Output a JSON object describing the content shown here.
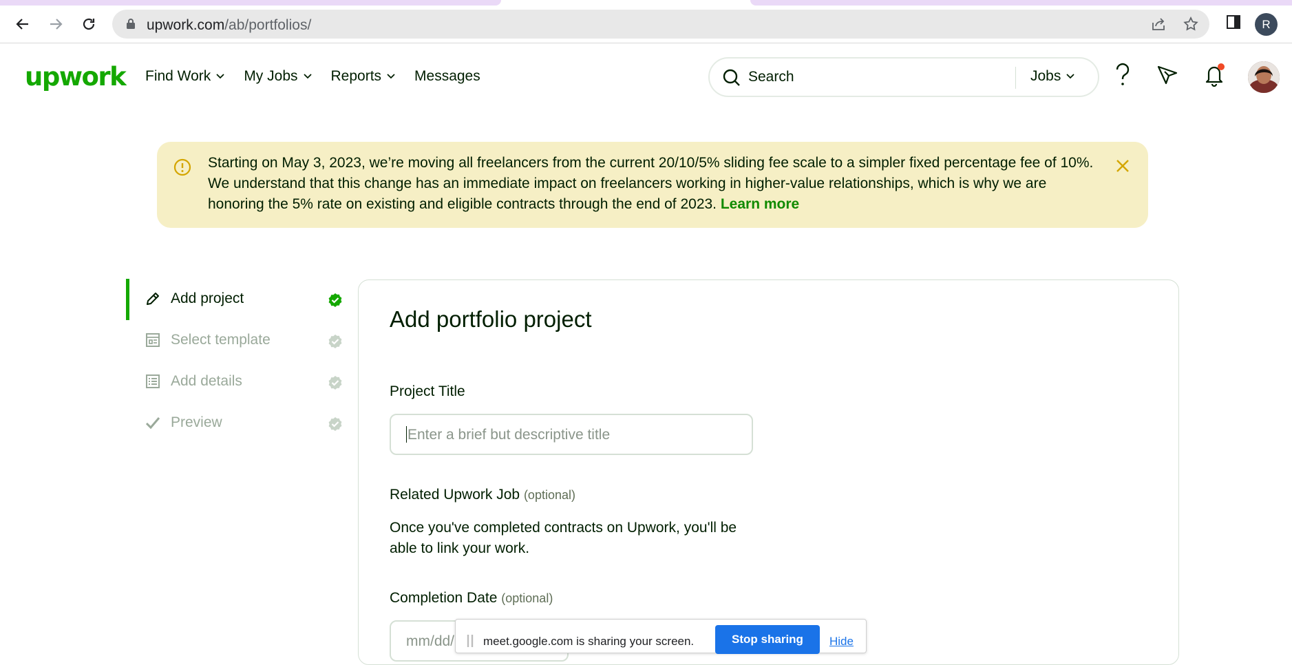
{
  "browser": {
    "url_host": "upwork.com",
    "url_path": "/ab/portfolios/",
    "profile_initial": "R"
  },
  "header": {
    "logo": "upwork",
    "nav": [
      {
        "label": "Find Work",
        "has_dropdown": true
      },
      {
        "label": "My Jobs",
        "has_dropdown": true
      },
      {
        "label": "Reports",
        "has_dropdown": true
      },
      {
        "label": "Messages",
        "has_dropdown": false
      }
    ],
    "search_placeholder": "Search",
    "search_category": "Jobs",
    "brand_color": "#14a800",
    "notification_dot_color": "#f04a26"
  },
  "banner": {
    "message": "Starting on May 3, 2023, we’re moving all freelancers from the current 20/10/5% sliding fee scale to a simpler fixed percentage fee of 10%. We understand that this change has an immediate impact on freelancers working in higher-value relationships, which is why we are honoring the 5% rate on existing and eligible contracts through the end of 2023.",
    "link_label": "Learn more",
    "background": "#f6efc5"
  },
  "steps": [
    {
      "label": "Add project",
      "icon": "pencil-icon",
      "state": "active"
    },
    {
      "label": "Select template",
      "icon": "template-icon",
      "state": "inactive"
    },
    {
      "label": "Add details",
      "icon": "list-icon",
      "state": "inactive"
    },
    {
      "label": "Preview",
      "icon": "checkmark-icon",
      "state": "inactive"
    }
  ],
  "form": {
    "title": "Add portfolio project",
    "project_title_label": "Project Title",
    "project_title_placeholder": "Enter a brief but descriptive title",
    "related_job_label": "Related Upwork Job",
    "related_job_optional": "(optional)",
    "related_job_help": "Once you've completed contracts on Upwork, you'll be able to link your work.",
    "completion_date_label": "Completion Date",
    "completion_date_optional": "(optional)",
    "completion_date_placeholder": "mm/dd/"
  },
  "sharing_bar": {
    "message": "meet.google.com is sharing your screen.",
    "stop_label": "Stop sharing",
    "hide_label": "Hide"
  }
}
